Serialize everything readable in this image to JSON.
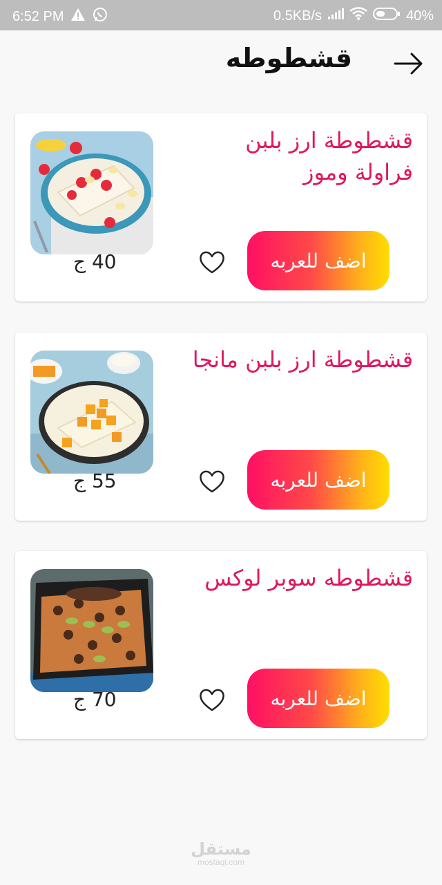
{
  "status_bar": {
    "time": "6:52 PM",
    "network_speed": "0.5KB/s",
    "battery": "40%",
    "icons": [
      "warning-icon",
      "whatsapp-icon",
      "signal-icon",
      "wifi-icon",
      "battery-icon"
    ]
  },
  "header": {
    "title": "قشطوطه",
    "back_icon": "arrow-right-icon"
  },
  "products": [
    {
      "name": "قشطوطة ارز بلبن فراولة وموز",
      "price": "40 ج",
      "button_label": "اضف للعربه",
      "image": "strawberry-banana-dessert"
    },
    {
      "name": "قشطوطة ارز بلبن مانجا",
      "price": "55 ج",
      "button_label": "اضف للعربه",
      "image": "mango-dessert"
    },
    {
      "name": "قشطوطه سوبر لوكس",
      "price": "70 ج",
      "button_label": "اضف للعربه",
      "image": "chocolate-pistachio-dessert"
    }
  ],
  "watermark": {
    "main": "مستقل",
    "sub": "mostaql.com"
  },
  "colors": {
    "title_pink": "#e0175f",
    "button_start": "#ff0f63",
    "button_end": "#ffde00",
    "status_bar": "#bdbdbd"
  }
}
